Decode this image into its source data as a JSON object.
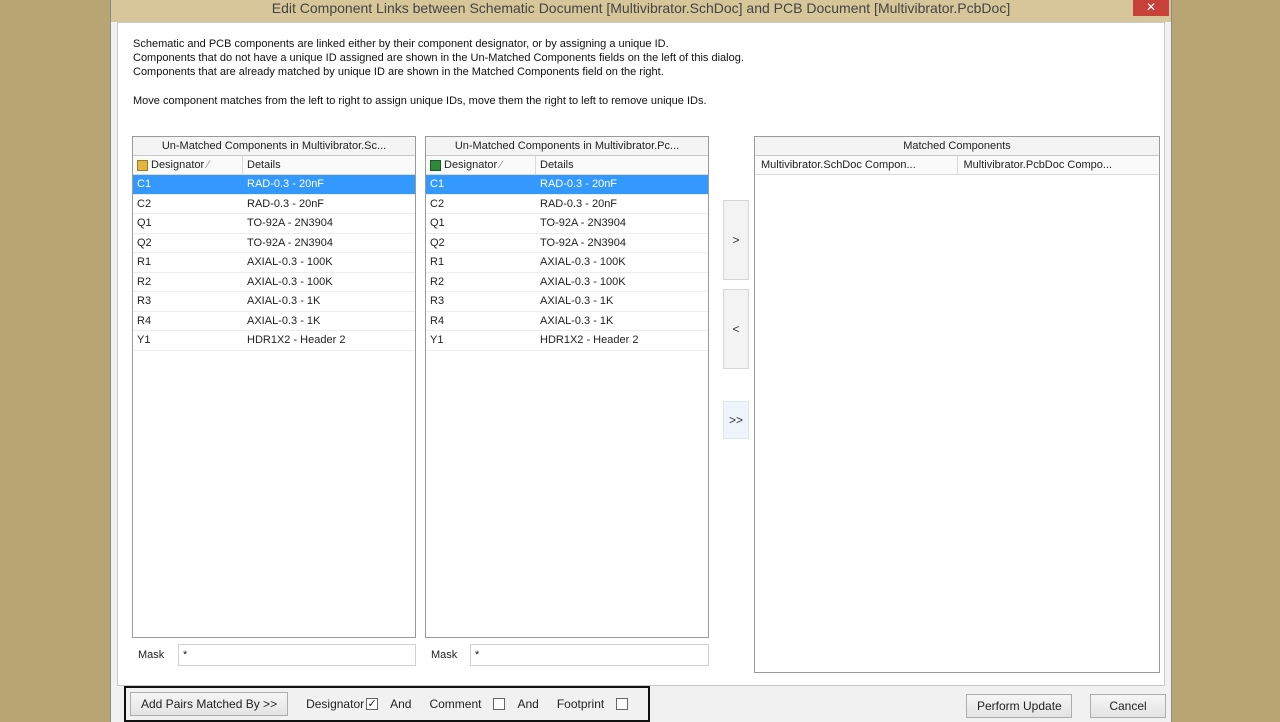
{
  "window": {
    "title": "Edit Component Links between Schematic Document [Multivibrator.SchDoc] and PCB Document [Multivibrator.PcbDoc]",
    "close_glyph": "✕"
  },
  "instructions": [
    "Schematic and PCB components are linked either by their component designator, or by assigning a unique ID.",
    "Components that do not have a unique ID assigned are shown in the Un-Matched Components fields on the left of this dialog.",
    "Components that are already matched by unique ID are shown in the Matched Components field on the right.",
    "Move component matches from the left to right to assign unique IDs, move them the right to left to remove unique IDs."
  ],
  "sch_panel": {
    "title": "Un-Matched Components in Multivibrator.Sc...",
    "col_designator": "Designator",
    "col_details": "Details",
    "rows": [
      {
        "designator": "C1",
        "details": "RAD-0.3 - 20nF"
      },
      {
        "designator": "C2",
        "details": "RAD-0.3 - 20nF"
      },
      {
        "designator": "Q1",
        "details": "TO-92A - 2N3904"
      },
      {
        "designator": "Q2",
        "details": "TO-92A - 2N3904"
      },
      {
        "designator": "R1",
        "details": "AXIAL-0.3 - 100K"
      },
      {
        "designator": "R2",
        "details": "AXIAL-0.3 - 100K"
      },
      {
        "designator": "R3",
        "details": "AXIAL-0.3 - 1K"
      },
      {
        "designator": "R4",
        "details": "AXIAL-0.3 - 1K"
      },
      {
        "designator": "Y1",
        "details": "HDR1X2 - Header 2"
      }
    ],
    "mask_label": "Mask",
    "mask_value": "*"
  },
  "pcb_panel": {
    "title": "Un-Matched Components in Multivibrator.Pc...",
    "col_designator": "Designator",
    "col_details": "Details",
    "rows": [
      {
        "designator": "C1",
        "details": "RAD-0.3 - 20nF"
      },
      {
        "designator": "C2",
        "details": "RAD-0.3 - 20nF"
      },
      {
        "designator": "Q1",
        "details": "TO-92A - 2N3904"
      },
      {
        "designator": "Q2",
        "details": "TO-92A - 2N3904"
      },
      {
        "designator": "R1",
        "details": "AXIAL-0.3 - 100K"
      },
      {
        "designator": "R2",
        "details": "AXIAL-0.3 - 100K"
      },
      {
        "designator": "R3",
        "details": "AXIAL-0.3 - 1K"
      },
      {
        "designator": "R4",
        "details": "AXIAL-0.3 - 1K"
      },
      {
        "designator": "Y1",
        "details": "HDR1X2 - Header 2"
      }
    ],
    "mask_label": "Mask",
    "mask_value": "*"
  },
  "move_buttons": {
    "add": ">",
    "remove": "<",
    "add_all": ">>"
  },
  "matched_panel": {
    "title": "Matched Components",
    "col_sch": "Multivibrator.SchDoc Compon...",
    "col_pcb": "Multivibrator.PcbDoc Compo..."
  },
  "bottom": {
    "add_pairs_label": "Add Pairs Matched By >>",
    "designator_label": "Designator",
    "designator_checked": "✓",
    "and1": "And",
    "comment_label": "Comment",
    "and2": "And",
    "footprint_label": "Footprint",
    "perform_update_label": "Perform Update",
    "cancel_label": "Cancel"
  }
}
